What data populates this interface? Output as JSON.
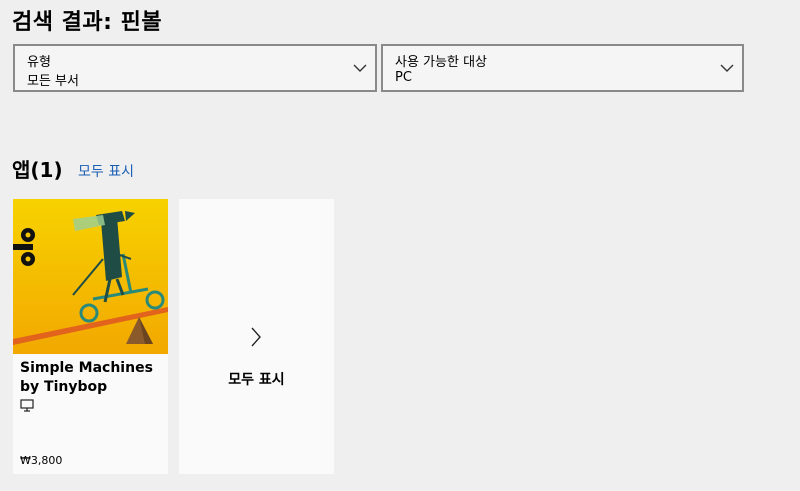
{
  "page": {
    "title": "검색 결과: 핀볼"
  },
  "filters": [
    {
      "label": "유형",
      "value": "모든 부서",
      "icon": "chevron-down-icon"
    },
    {
      "label": "사용 가능한 대상",
      "value": "PC",
      "icon": "chevron-down-icon"
    }
  ],
  "apps_section": {
    "title": "앱(1)",
    "show_all": "모두 표시",
    "items": [
      {
        "name": "Simple Machines by Tinybop",
        "device_icon": "pc-icon",
        "price": "₩3,800"
      }
    ],
    "more_card": {
      "label": "모두 표시",
      "icon": "chevron-right-icon"
    }
  },
  "colors": {
    "background": "#efefef",
    "link": "#1a5fb4",
    "thumbnail_bg": "#f5b800"
  }
}
